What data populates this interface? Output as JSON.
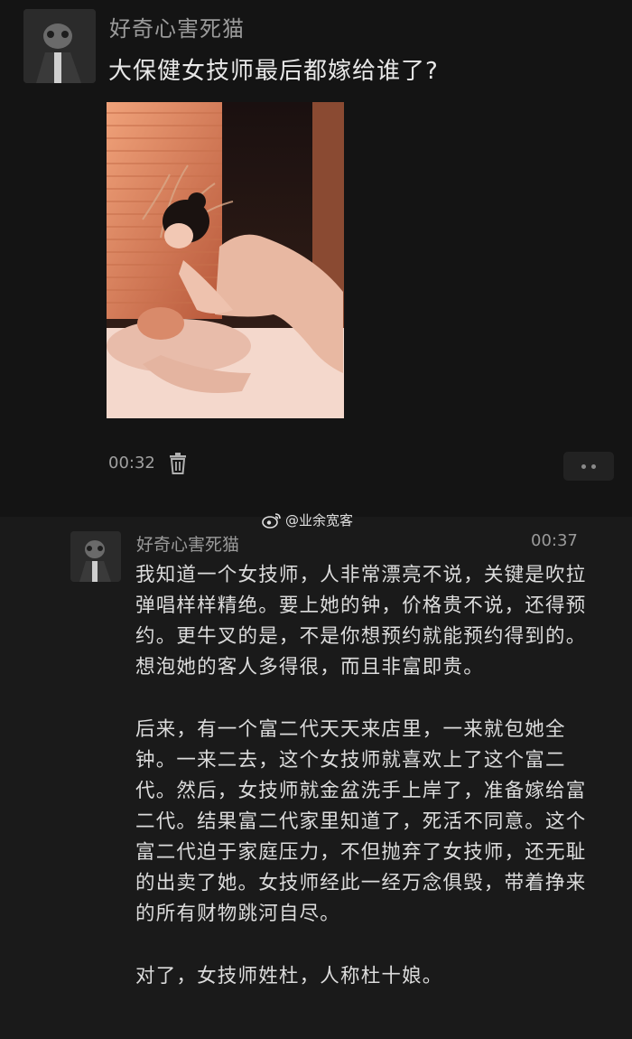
{
  "post": {
    "author": "好奇心害死猫",
    "title": "大保健女技师最后都嫁给谁了?",
    "time": "00:32",
    "icons": {
      "delete": "trash-icon",
      "more": "more-dots-icon"
    }
  },
  "comment": {
    "author": "好奇心害死猫",
    "time": "00:37",
    "paragraphs": [
      "我知道一个女技师，人非常漂亮不说，关键是吹拉弹唱样样精绝。要上她的钟，价格贵不说，还得预约。更牛叉的是，不是你想预约就能预约得到的。想泡她的客人多得很，而且非富即贵。",
      "后来，有一个富二代天天来店里，一来就包她全钟。一来二去，这个女技师就喜欢上了这个富二代。然后，女技师就金盆洗手上岸了，准备嫁给富二代。结果富二代家里知道了，死活不同意。这个富二代迫于家庭压力，不但抛弃了女技师，还无耻的出卖了她。女技师经此一经万念俱毁，带着挣来的所有财物跳河自尽。",
      "对了，女技师姓杜，人称杜十娘。"
    ]
  },
  "watermark": {
    "text": "@业余宽客",
    "icon": "weibo-icon"
  }
}
